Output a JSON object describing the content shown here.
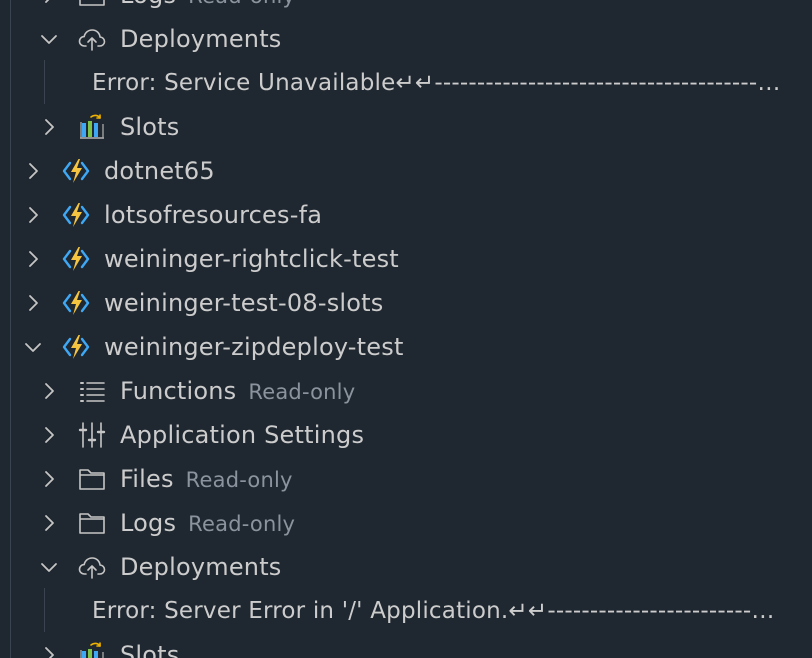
{
  "tree": {
    "items": [
      {
        "label": "Logs",
        "description": "Read-only"
      },
      {
        "label": "Deployments"
      },
      {
        "label": "Error: Service Unavailable↵↵--------------------------------------------------------"
      },
      {
        "label": "Slots"
      },
      {
        "label": "dotnet65"
      },
      {
        "label": "lotsofresources-fa"
      },
      {
        "label": "weininger-rightclick-test"
      },
      {
        "label": "weininger-test-08-slots"
      },
      {
        "label": "weininger-zipdeploy-test"
      },
      {
        "label": "Functions",
        "description": "Read-only"
      },
      {
        "label": "Application Settings"
      },
      {
        "label": "Files",
        "description": "Read-only"
      },
      {
        "label": "Logs",
        "description": "Read-only"
      },
      {
        "label": "Deployments"
      },
      {
        "label": "Error: Server Error in '/' Application.↵↵--------------------------------------------------------"
      },
      {
        "label": "Slots"
      }
    ]
  },
  "colors": {
    "background": "#1f2730",
    "text": "#cccccc",
    "description": "#8b949e",
    "function_bolt": "#f5c542",
    "function_bracket": "#3ea8f5"
  },
  "icons": {
    "collapsed": "chevron-right-icon",
    "expanded": "chevron-down-icon",
    "folder": "folder-icon",
    "cloud": "cloud-upload-icon",
    "slots": "slots-icon",
    "function_app": "function-app-icon",
    "list": "list-icon",
    "settings": "settings-sliders-icon"
  }
}
